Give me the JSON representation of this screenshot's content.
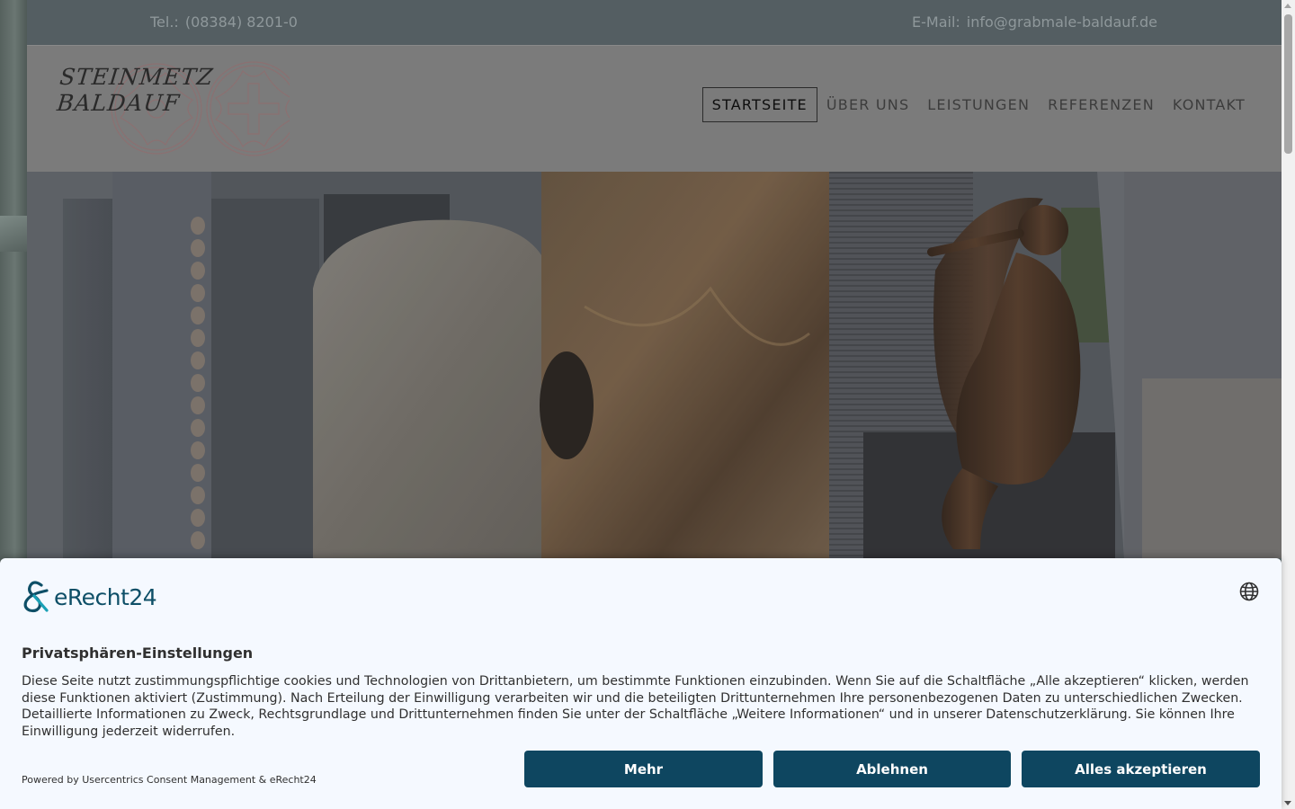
{
  "topbar": {
    "phone_label": "Tel.:",
    "phone": "(08384) 8201-0",
    "email_label": "E-Mail:",
    "email": "info@grabmale-baldauf.de"
  },
  "logo": {
    "line1": "STEINMETZ",
    "line2": "BALDAUF",
    "icon": "tracery-window-emblem-icon"
  },
  "nav": {
    "items": [
      {
        "label": "STARTSEITE",
        "active": true
      },
      {
        "label": "ÜBER UNS",
        "active": false
      },
      {
        "label": "LEISTUNGEN",
        "active": false
      },
      {
        "label": "REFERENZEN",
        "active": false
      },
      {
        "label": "KONTAKT",
        "active": false
      }
    ]
  },
  "hero": {
    "subject": "gravestones-with-bronze-angel-photo"
  },
  "consent": {
    "brand": "eRecht24",
    "brand_icon": "erecht24-ampersand-logo-icon",
    "language_icon": "globe-icon",
    "title": "Privatsphären-Einstellungen",
    "description": "Diese Seite nutzt zustimmungspflichtige cookies und Technologien von Drittanbietern, um bestimmte Funktionen einzubinden. Wenn Sie auf die Schaltfläche „Alle akzeptieren“ klicken, werden diese Funktionen aktiviert (Zustimmung). Nach Erteilung der Einwilligung verarbeiten wir und die beteiligten Drittunternehmen Ihre personenbezogenen Daten zu unterschiedlichen Zwecken. Detaillierte Informationen zu Zweck, Rechtsgrundlage und Drittunternehmen finden Sie unter der Schaltfläche „Weitere Informationen“ und in unserer Datenschutzerklärung. Sie können Ihre Einwilligung jederzeit widerrufen.",
    "powered_by": "Powered by Usercentrics Consent Management & eRecht24",
    "buttons": {
      "more": "Mehr",
      "deny": "Ablehnen",
      "accept": "Alles akzeptieren"
    }
  },
  "colors": {
    "topbar_bg": "#545e62",
    "header_bg": "#7b7b7b",
    "consent_bg": "#f5f9ff",
    "button_bg": "#0e4660",
    "brand_accent": "#0e4f67"
  }
}
